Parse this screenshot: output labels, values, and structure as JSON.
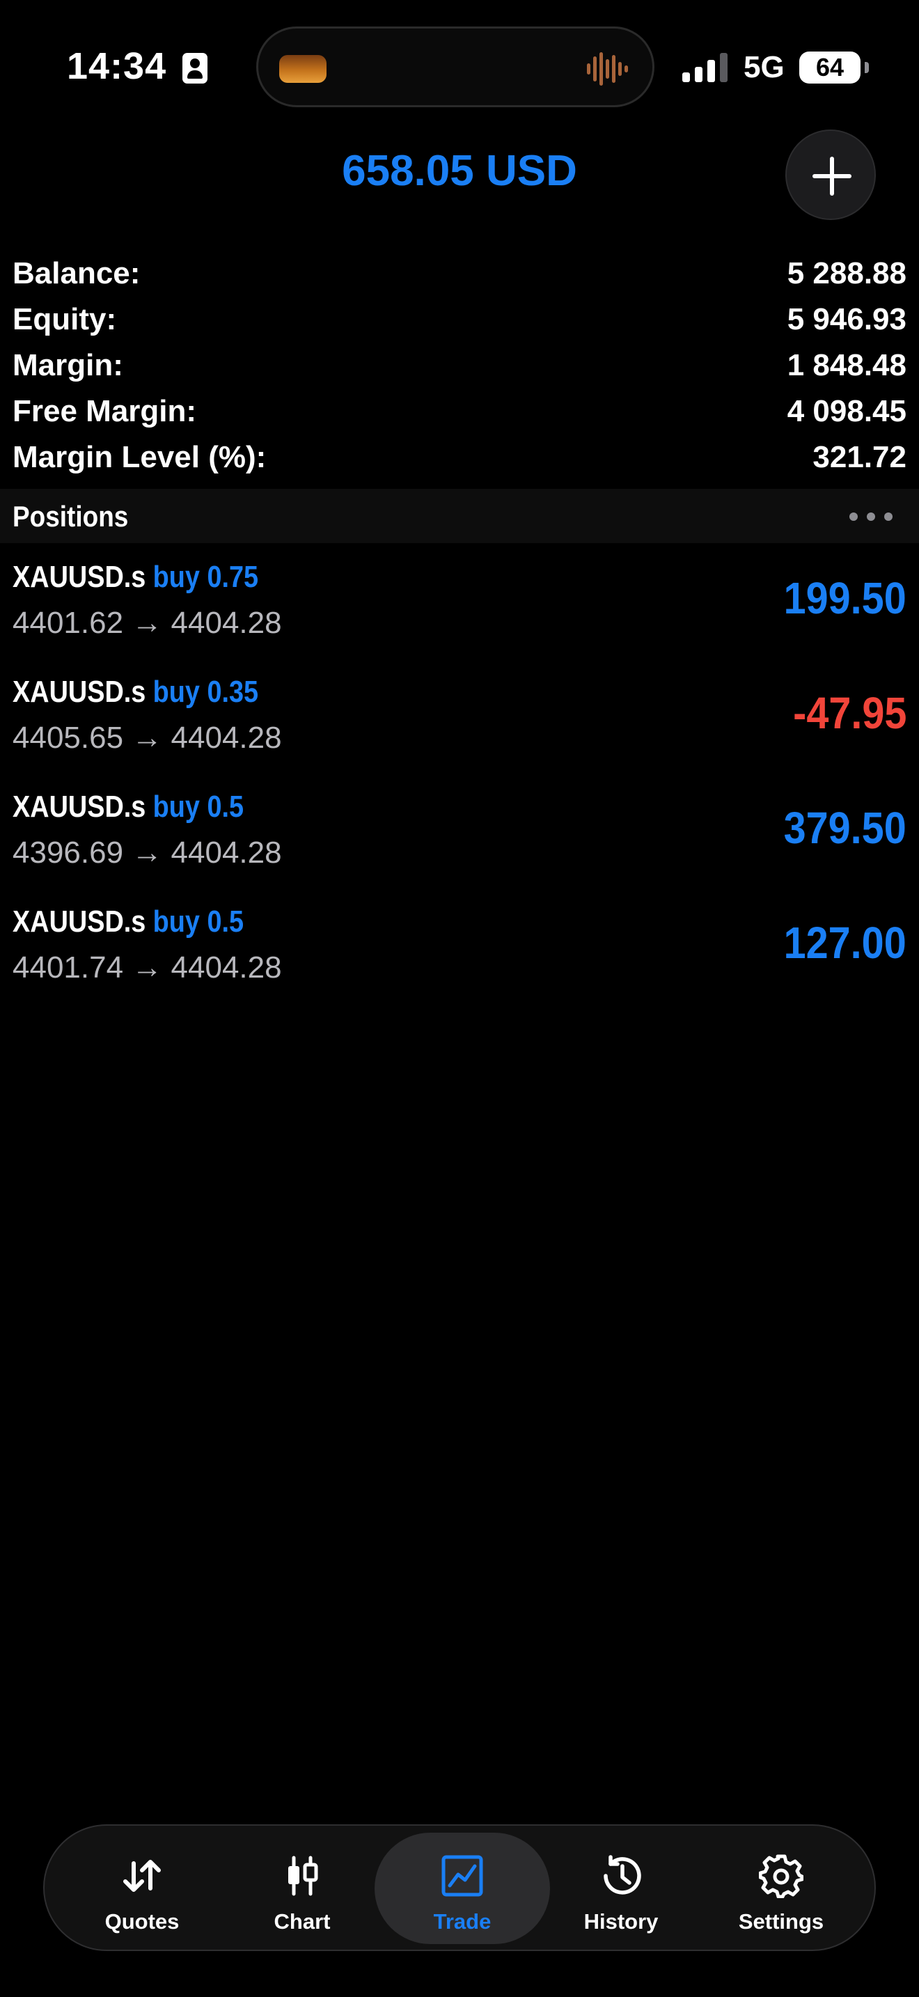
{
  "status": {
    "time": "14:34",
    "network": "5G",
    "battery": "64"
  },
  "header": {
    "profit": "658.05 USD"
  },
  "summary": [
    {
      "label": "Balance:",
      "value": "5 288.88"
    },
    {
      "label": "Equity:",
      "value": "5 946.93"
    },
    {
      "label": "Margin:",
      "value": "1 848.48"
    },
    {
      "label": "Free Margin:",
      "value": "4 098.45"
    },
    {
      "label": "Margin Level (%):",
      "value": "321.72"
    }
  ],
  "positions": {
    "title": "Positions",
    "items": [
      {
        "symbol": "XAUUSD.s",
        "side": "buy 0.75",
        "open": "4401.62",
        "current": "4404.28",
        "profit": "199.50"
      },
      {
        "symbol": "XAUUSD.s",
        "side": "buy 0.35",
        "open": "4405.65",
        "current": "4404.28",
        "profit": "-47.95"
      },
      {
        "symbol": "XAUUSD.s",
        "side": "buy 0.5",
        "open": "4396.69",
        "current": "4404.28",
        "profit": "379.50"
      },
      {
        "symbol": "XAUUSD.s",
        "side": "buy 0.5",
        "open": "4401.74",
        "current": "4404.28",
        "profit": "127.00"
      }
    ]
  },
  "tabs": [
    {
      "label": "Quotes",
      "icon": "quotes-arrows-icon"
    },
    {
      "label": "Chart",
      "icon": "candlestick-icon"
    },
    {
      "label": "Trade",
      "icon": "trade-chart-icon",
      "active": true
    },
    {
      "label": "History",
      "icon": "history-clock-icon"
    },
    {
      "label": "Settings",
      "icon": "gear-icon"
    }
  ],
  "colors": {
    "accent": "#1a7ff5",
    "loss": "#f2453a",
    "secondary_text": "#b8b8bd",
    "background": "#000000"
  }
}
